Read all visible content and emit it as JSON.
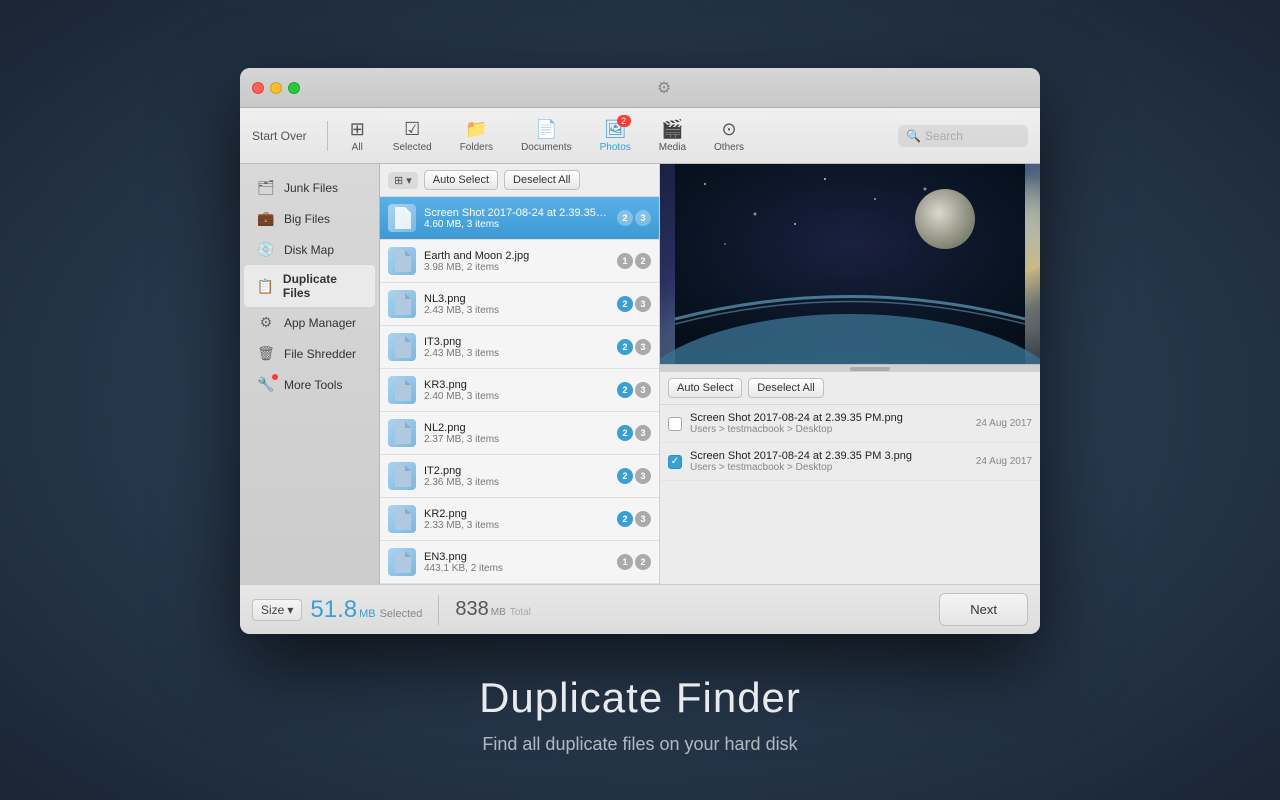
{
  "window": {
    "title": "Duplicate Finder"
  },
  "titlebar": {
    "traffic_lights": [
      "close",
      "minimize",
      "maximize"
    ]
  },
  "toolbar": {
    "start_over": "Start Over",
    "items": [
      {
        "id": "all",
        "label": "All",
        "icon": "⊞",
        "active": false,
        "badge": null
      },
      {
        "id": "selected",
        "label": "Selected",
        "icon": "✓",
        "active": false,
        "badge": null
      },
      {
        "id": "folders",
        "label": "Folders",
        "icon": "📁",
        "active": false,
        "badge": null
      },
      {
        "id": "documents",
        "label": "Documents",
        "icon": "📄",
        "active": false,
        "badge": null
      },
      {
        "id": "photos",
        "label": "Photos",
        "icon": "🖼",
        "active": true,
        "badge": "2"
      },
      {
        "id": "media",
        "label": "Media",
        "icon": "🎬",
        "active": false,
        "badge": null
      },
      {
        "id": "others",
        "label": "Others",
        "icon": "⊙",
        "active": false,
        "badge": null
      }
    ],
    "search_placeholder": "Search"
  },
  "sidebar": {
    "items": [
      {
        "id": "junk-files",
        "label": "Junk Files",
        "icon": "🗂",
        "active": false
      },
      {
        "id": "big-files",
        "label": "Big Files",
        "icon": "💼",
        "active": false
      },
      {
        "id": "disk-map",
        "label": "Disk Map",
        "icon": "💿",
        "active": false
      },
      {
        "id": "duplicate-files",
        "label": "Duplicate Files",
        "icon": "📋",
        "active": true
      },
      {
        "id": "app-manager",
        "label": "App Manager",
        "icon": "⚙",
        "active": false
      },
      {
        "id": "file-shredder",
        "label": "File Shredder",
        "icon": "🗑",
        "active": false
      },
      {
        "id": "more-tools",
        "label": "More Tools",
        "icon": "🔧",
        "active": false
      }
    ]
  },
  "file_list": {
    "view_toggle": "⊞",
    "auto_select": "Auto Select",
    "deselect_all": "Deselect All",
    "items": [
      {
        "id": "item-1",
        "name": "Screen Shot 2017-08-24 at 2.39.35 P...",
        "meta": "4.60 MB, 3 items",
        "badge1": "2",
        "badge2": "3",
        "selected": true
      },
      {
        "id": "item-2",
        "name": "Earth and Moon 2.jpg",
        "meta": "3.98 MB, 2 items",
        "badge1": "1",
        "badge2": "2",
        "selected": false
      },
      {
        "id": "item-3",
        "name": "NL3.png",
        "meta": "2.43 MB, 3 items",
        "badge1": "2",
        "badge2": "3",
        "selected": false
      },
      {
        "id": "item-4",
        "name": "IT3.png",
        "meta": "2.43 MB, 3 items",
        "badge1": "2",
        "badge2": "3",
        "selected": false
      },
      {
        "id": "item-5",
        "name": "KR3.png",
        "meta": "2.40 MB, 3 items",
        "badge1": "2",
        "badge2": "3",
        "selected": false
      },
      {
        "id": "item-6",
        "name": "NL2.png",
        "meta": "2.37 MB, 3 items",
        "badge1": "2",
        "badge2": "3",
        "selected": false
      },
      {
        "id": "item-7",
        "name": "IT2.png",
        "meta": "2.36 MB, 3 items",
        "badge1": "2",
        "badge2": "3",
        "selected": false
      },
      {
        "id": "item-8",
        "name": "KR2.png",
        "meta": "2.33 MB, 3 items",
        "badge1": "2",
        "badge2": "3",
        "selected": false
      },
      {
        "id": "item-9",
        "name": "EN3.png",
        "meta": "443.1 KB, 2 items",
        "badge1": "1",
        "badge2": "2",
        "selected": false
      }
    ]
  },
  "preview": {
    "auto_select": "Auto Select",
    "deselect_all": "Deselect All",
    "items": [
      {
        "id": "preview-1",
        "name": "Screen Shot 2017-08-24 at 2.39.35 PM.png",
        "path": "Users > testmacbook > Desktop",
        "date": "24 Aug 2017",
        "checked": false
      },
      {
        "id": "preview-2",
        "name": "Screen Shot 2017-08-24 at 2.39.35 PM 3.png",
        "path": "Users > testmacbook > Desktop",
        "date": "24 Aug 2017",
        "checked": true
      }
    ]
  },
  "footer": {
    "sort_label": "Size",
    "selected_size": "51.8",
    "selected_unit": "MB",
    "selected_label": "Selected",
    "total_size": "838",
    "total_unit": "MB",
    "total_label": "Total",
    "next_button": "Next"
  },
  "bottom": {
    "title": "Duplicate Finder",
    "subtitle": "Find all duplicate files on your hard disk"
  }
}
